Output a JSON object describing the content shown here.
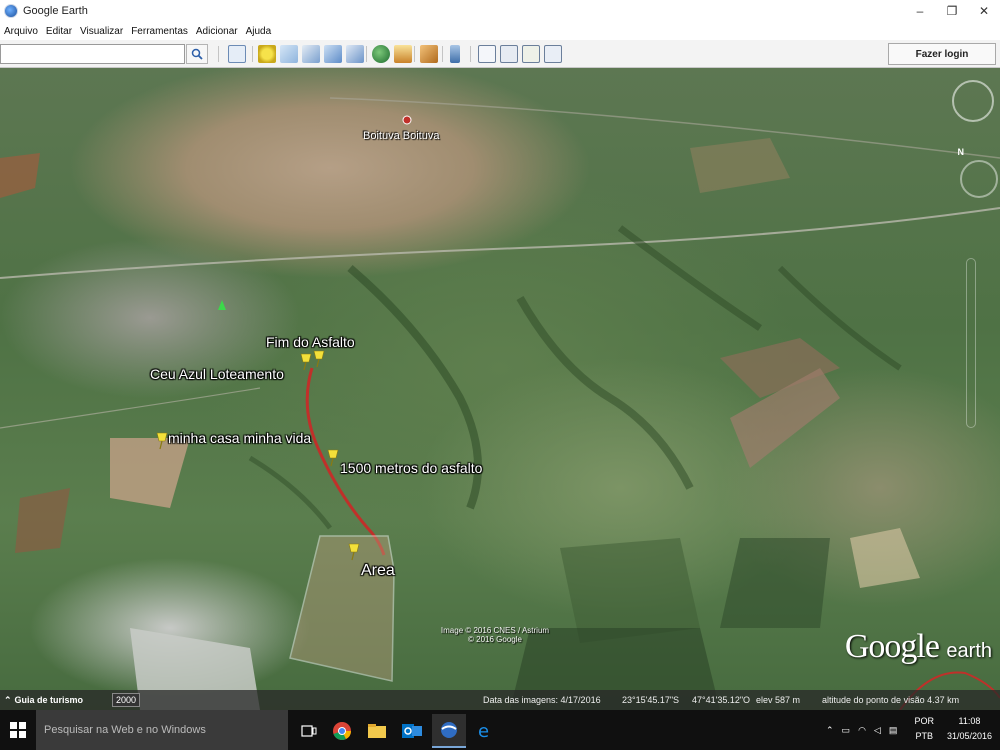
{
  "window": {
    "title": "Google Earth",
    "controls": [
      "–",
      "❐",
      "✕"
    ]
  },
  "menu": [
    "Arquivo",
    "Editar",
    "Visualizar",
    "Ferramentas",
    "Adicionar",
    "Ajuda"
  ],
  "toolbar": {
    "search_value": "",
    "login_label": "Fazer login"
  },
  "map": {
    "city_label": "Boituva Boituva",
    "placemarks": [
      {
        "label": "Fim do Asfalto"
      },
      {
        "label": "Ceu Azul Loteamento"
      },
      {
        "label": "minha casa minha vida"
      },
      {
        "label": "1500 metros do asfalto"
      },
      {
        "label": "Area"
      }
    ],
    "credits_line1": "Image © 2016 CNES / Astrium",
    "credits_line2": "© 2016 Google",
    "logo_text": "Google",
    "logo_suffix": "earth",
    "nav_north": "N"
  },
  "statusbar": {
    "tour_label": "Guia de turismo",
    "year_label": "2000",
    "image_date": "Data das imagens: 4/17/2016",
    "latitude": "23°15'45.17\"S",
    "longitude": "47°41'35.12\"O",
    "elevation": "elev  587 m",
    "eye_altitude": "altitude do ponto de visão  4.37 km"
  },
  "taskbar": {
    "search_placeholder": "Pesquisar na Web e no Windows",
    "language_top": "POR",
    "language_bottom": "PTB",
    "time": "11:08",
    "date": "31/05/2016"
  },
  "colors": {
    "pin": "#f3e03a",
    "road": "#c0302a",
    "area_outline": "#ffffff"
  }
}
